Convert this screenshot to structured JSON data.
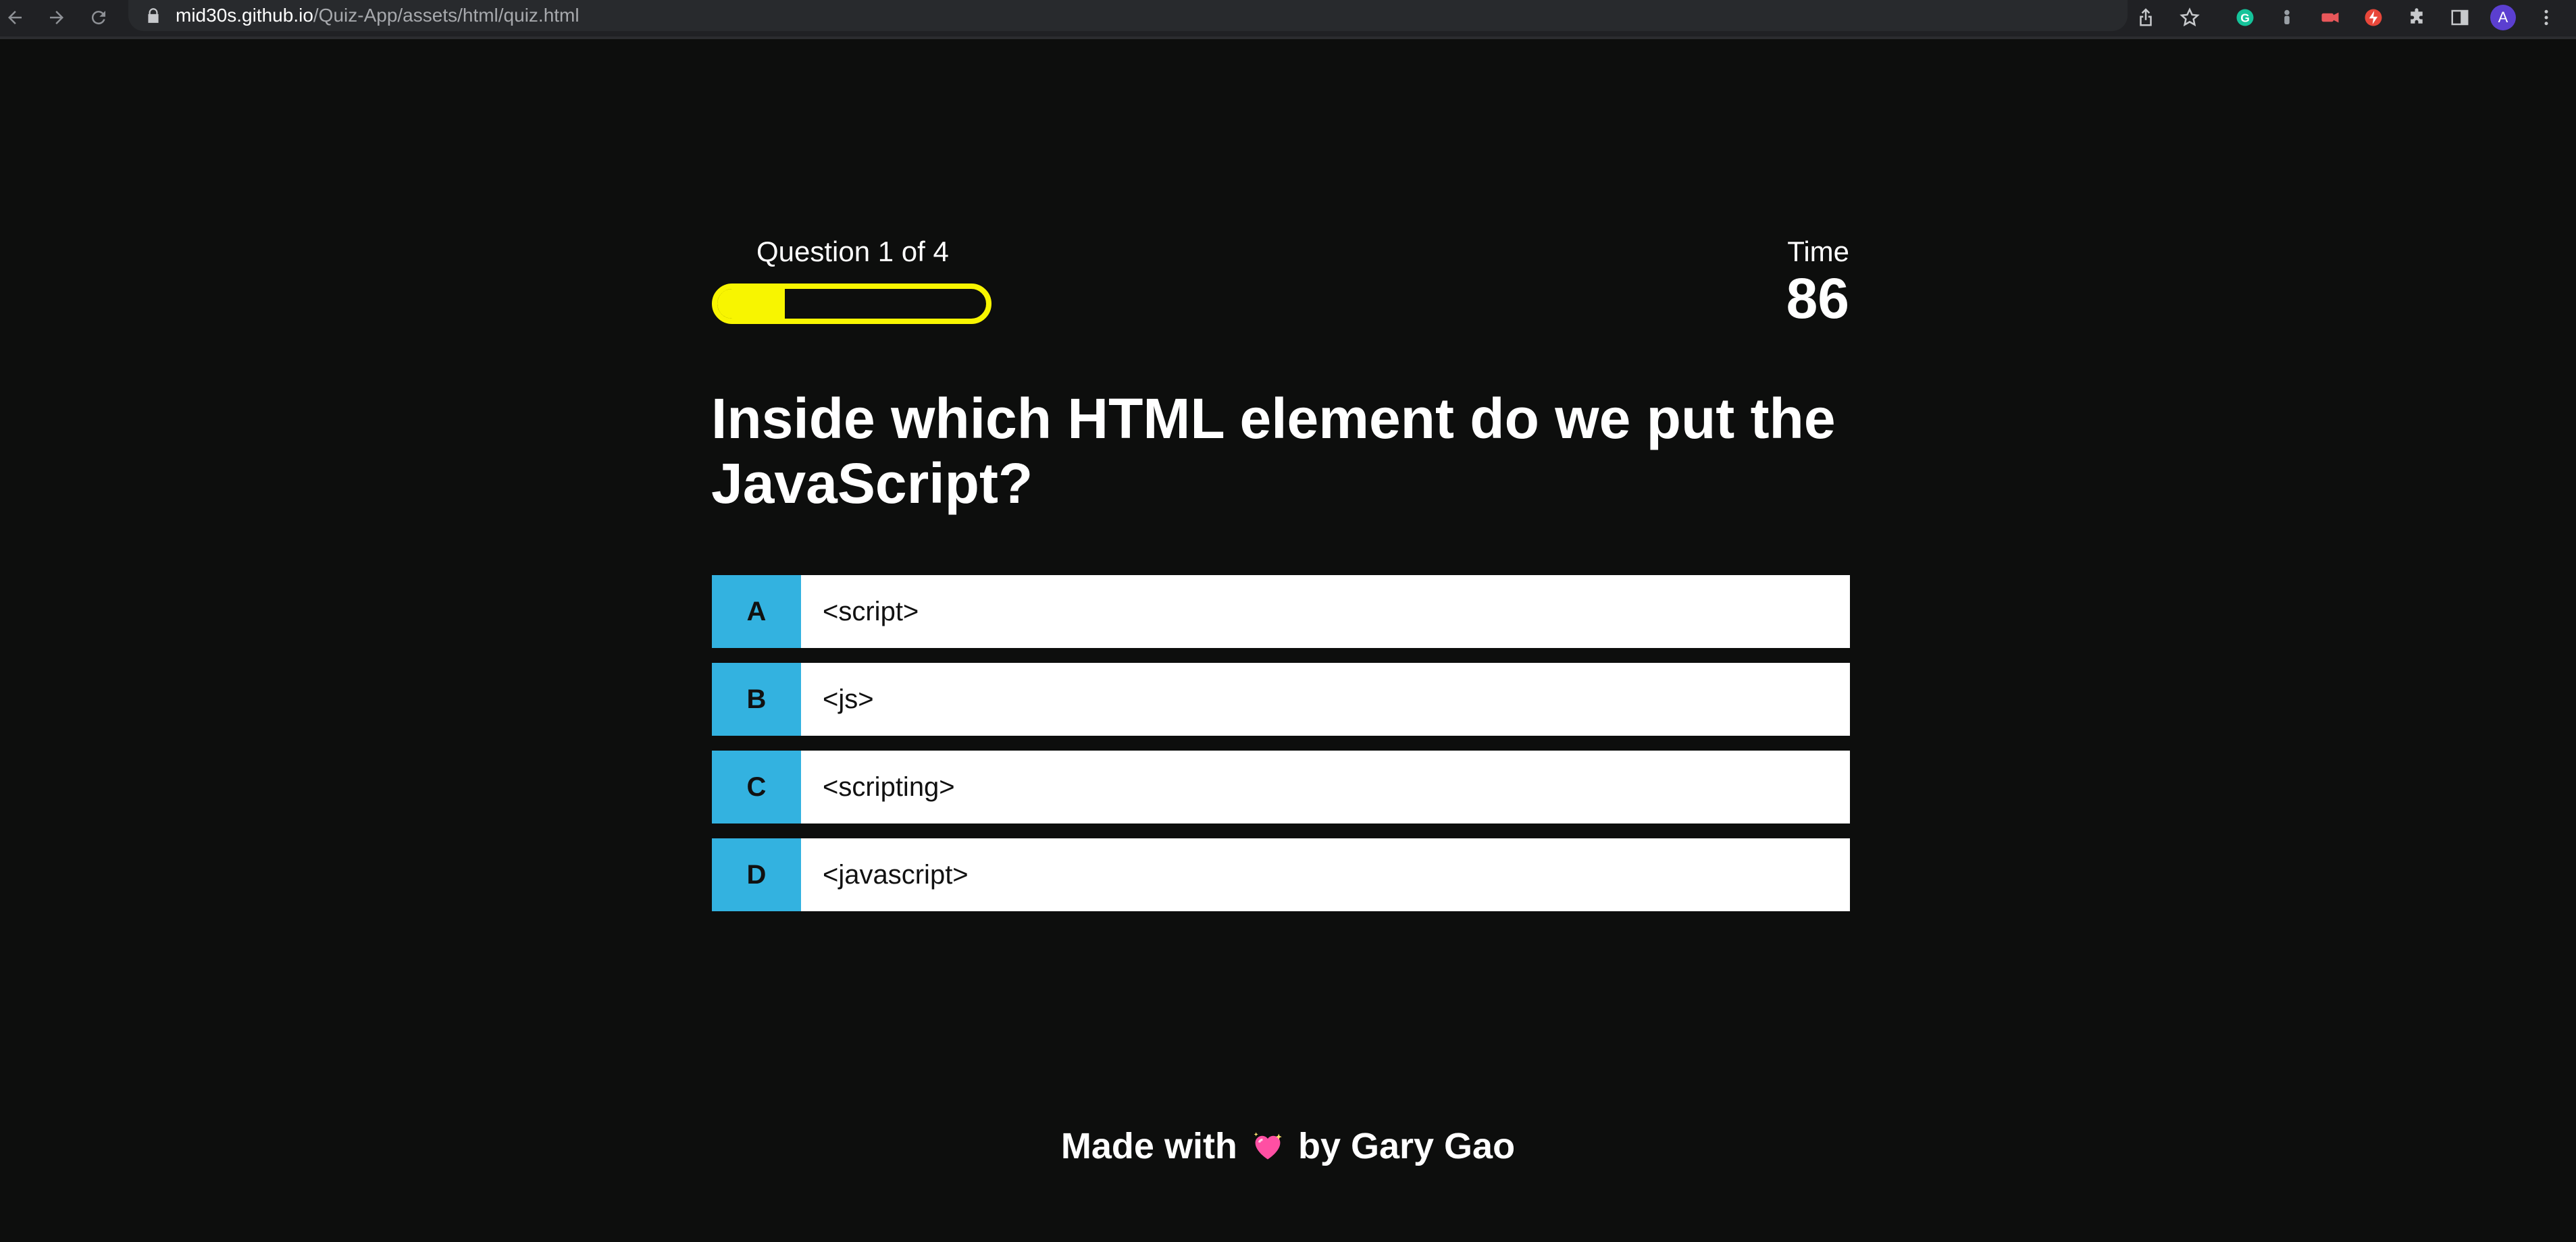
{
  "browser": {
    "url_host": "mid30s.github.io",
    "url_path": "/Quiz-App/assets/html/quiz.html",
    "profile_initial": "A",
    "icons": [
      "back-arrow-icon",
      "forward-arrow-icon",
      "reload-icon",
      "lock-icon",
      "share-icon",
      "star-icon",
      "grammarly-icon",
      "extension-icon",
      "extensions-puzzle-icon",
      "side-panel-icon",
      "more-menu-icon"
    ]
  },
  "hud": {
    "progress_text": "Question 1 of 4",
    "progress": {
      "current": 1,
      "total": 4
    },
    "time_label": "Time",
    "time_value": "86"
  },
  "question": {
    "text": "Inside which HTML element do we put the JavaScript?"
  },
  "choices": [
    {
      "prefix": "A",
      "text": "<script>"
    },
    {
      "prefix": "B",
      "text": "<js>"
    },
    {
      "prefix": "C",
      "text": "<scripting>"
    },
    {
      "prefix": "D",
      "text": "<javascript>"
    }
  ],
  "footer": {
    "before": "Made with",
    "icon": "sparkling-heart-icon",
    "after": "by Gary Gao"
  },
  "colors": {
    "background": "#0d0e0d",
    "progress": "#f8f500",
    "choice_prefix": "#33b2e0",
    "choice_bg": "#ffffff",
    "heart": "#ff4fa3"
  }
}
